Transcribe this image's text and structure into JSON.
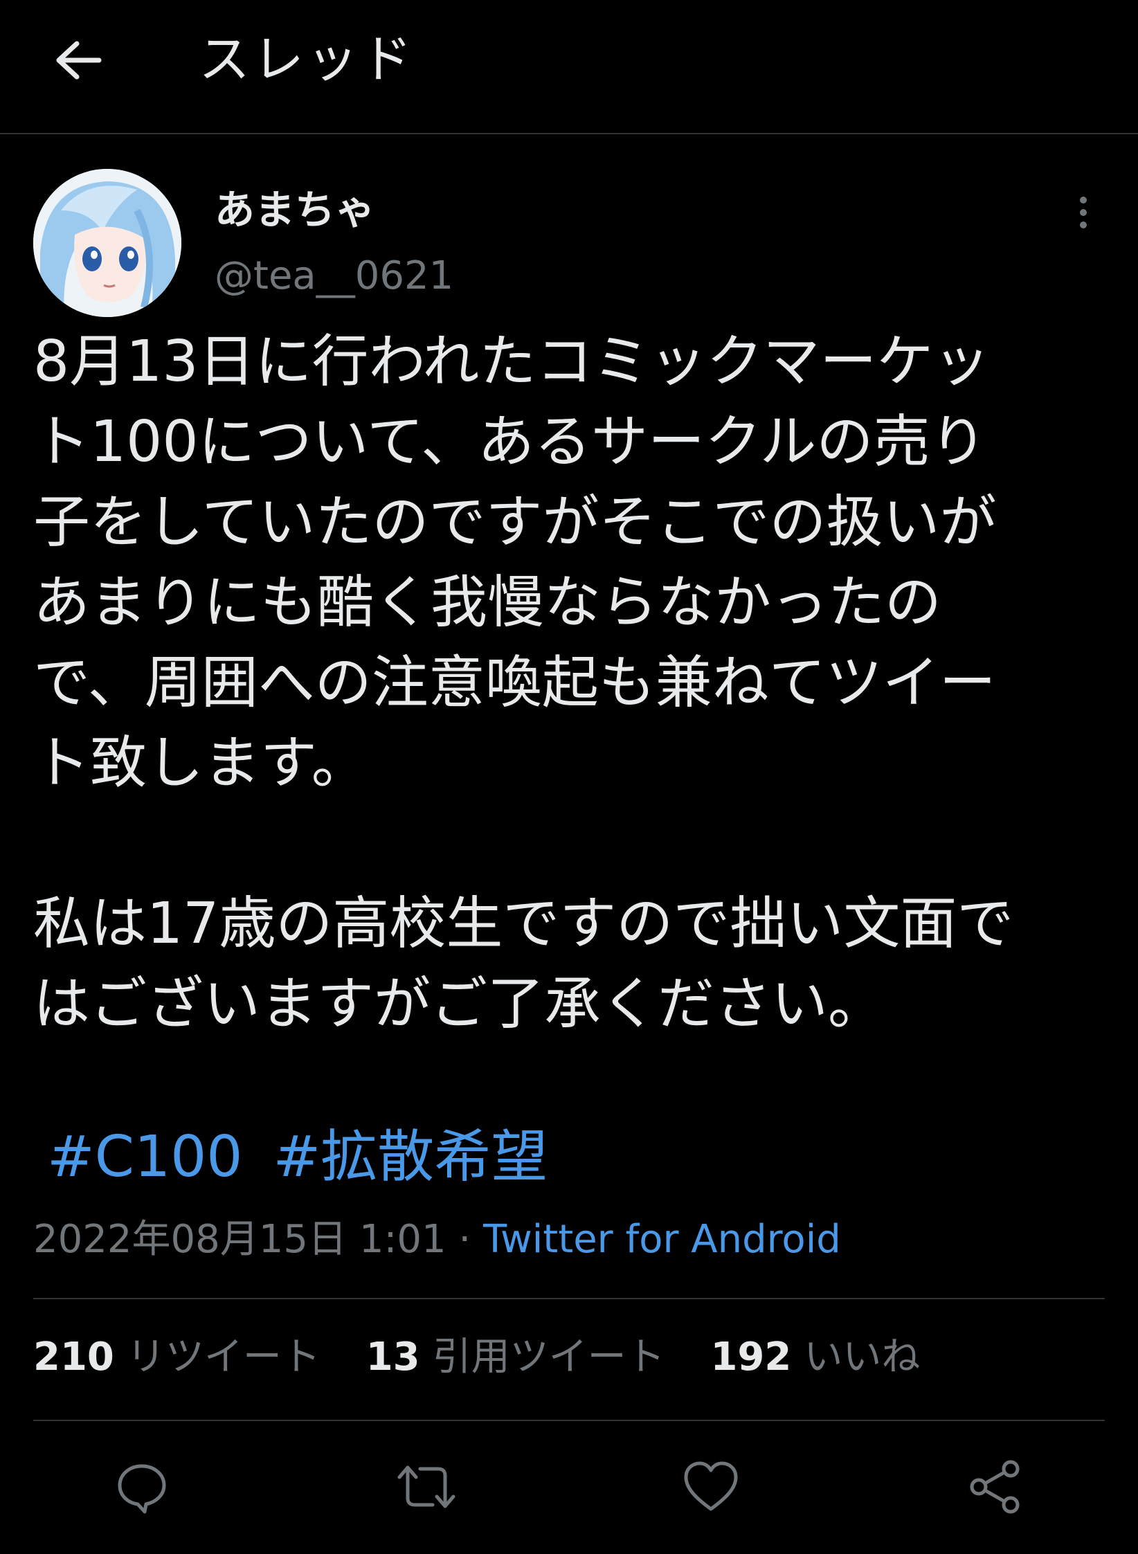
{
  "header": {
    "title": "スレッド"
  },
  "author": {
    "display_name": "あまちゃ",
    "handle": "@tea__0621"
  },
  "tweet": {
    "paragraph1": "8月13日に行われたコミックマーケッ\nト100について、あるサークルの売り\n子をしていたのですがそこでの扱いが\nあまりにも酷く我慢ならなかったの\nで、周囲への注意喚起も兼ねてツイー\nト致します。",
    "paragraph2": "私は17歳の高校生ですので拙い文面で\nはございますがご了承ください。",
    "hashtags": [
      "#C100",
      "#拡散希望"
    ]
  },
  "meta": {
    "timestamp": "2022年08月15日 1:01",
    "separator": " · ",
    "source": "Twitter for Android"
  },
  "stats": {
    "retweets": {
      "count": "210",
      "label": "リツイート"
    },
    "quotes": {
      "count": "13",
      "label": "引用ツイート"
    },
    "likes": {
      "count": "192",
      "label": "いいね"
    }
  },
  "colors": {
    "background": "#000000",
    "text": "#e7e9ea",
    "muted": "#71767b",
    "accent": "#4a99e9",
    "divider": "#2f3336"
  },
  "icons": {
    "back": "arrow-left-icon",
    "more": "more-vertical-icon",
    "reply": "reply-icon",
    "retweet": "retweet-icon",
    "like": "heart-icon",
    "share": "share-icon"
  }
}
